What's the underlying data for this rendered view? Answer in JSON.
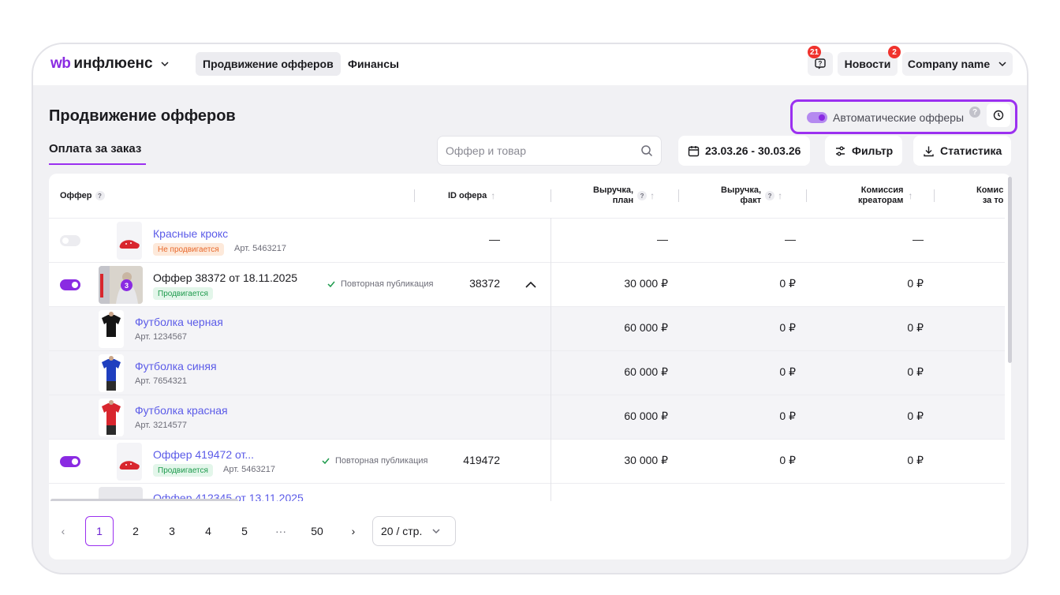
{
  "topbar": {
    "logo_wb": "wb",
    "logo_brand": "инфлюенс",
    "nav": [
      "Продвижение офферов",
      "Финансы"
    ],
    "support_badge": "21",
    "news_label": "Новости",
    "news_badge": "2",
    "company_label": "Company name"
  },
  "page": {
    "title": "Продвижение офферов",
    "tab": "Оплата за заказ",
    "auto_offers_label": "Автоматические офферы",
    "search_placeholder": "Оффер и товар",
    "date_range": "23.03.26 - 30.03.26",
    "filter_label": "Фильтр",
    "stats_label": "Статистика"
  },
  "table": {
    "headers": {
      "offer": "Оффер",
      "id": "ID офера",
      "rev_plan_1": "Выручка,",
      "rev_plan_2": "план",
      "rev_fact_1": "Выручка,",
      "rev_fact_2": "факт",
      "commission_1": "Комиссия",
      "commission_2": "креаторам",
      "comm2_1": "Комис",
      "comm2_2": "за то"
    },
    "rows": [
      {
        "title": "Красные крокс",
        "status": "Не продвигается",
        "art": "Арт. 5463217",
        "id": "—",
        "plan": "—",
        "fact": "—",
        "comm": "—"
      },
      {
        "title": "Оффер 38372 от 18.11.2025",
        "thumb_count": "3",
        "status": "Продвигается",
        "repub": "Повторная публикация",
        "id": "38372",
        "plan": "30 000 ₽",
        "fact": "0 ₽",
        "comm": "0 ₽"
      },
      {
        "title": "Футболка черная",
        "art": "Арт. 1234567",
        "plan": "60 000 ₽",
        "fact": "0 ₽",
        "comm": "0 ₽"
      },
      {
        "title": "Футболка синяя",
        "art": "Арт. 7654321",
        "plan": "60 000 ₽",
        "fact": "0 ₽",
        "comm": "0 ₽"
      },
      {
        "title": "Футболка красная",
        "art": "Арт. 3214577",
        "plan": "60 000 ₽",
        "fact": "0 ₽",
        "comm": "0 ₽"
      },
      {
        "title": "Оффер 419472 от...",
        "status": "Продвигается",
        "art": "Арт. 5463217",
        "repub": "Повторная публикация",
        "id": "419472",
        "plan": "30 000 ₽",
        "fact": "0 ₽",
        "comm": "0 ₽"
      },
      {
        "title": "Оффер 412345 от 13.11.2025"
      }
    ]
  },
  "pagination": {
    "pages": [
      "1",
      "2",
      "3",
      "4",
      "5",
      "···",
      "50"
    ],
    "per_page": "20 / стр."
  },
  "colors": {
    "accent": "#9b30f0",
    "link": "#5b5be8",
    "badge_red": "#f0322d",
    "green_tag": "#1d9a4c",
    "orange_tag": "#e8692c"
  }
}
